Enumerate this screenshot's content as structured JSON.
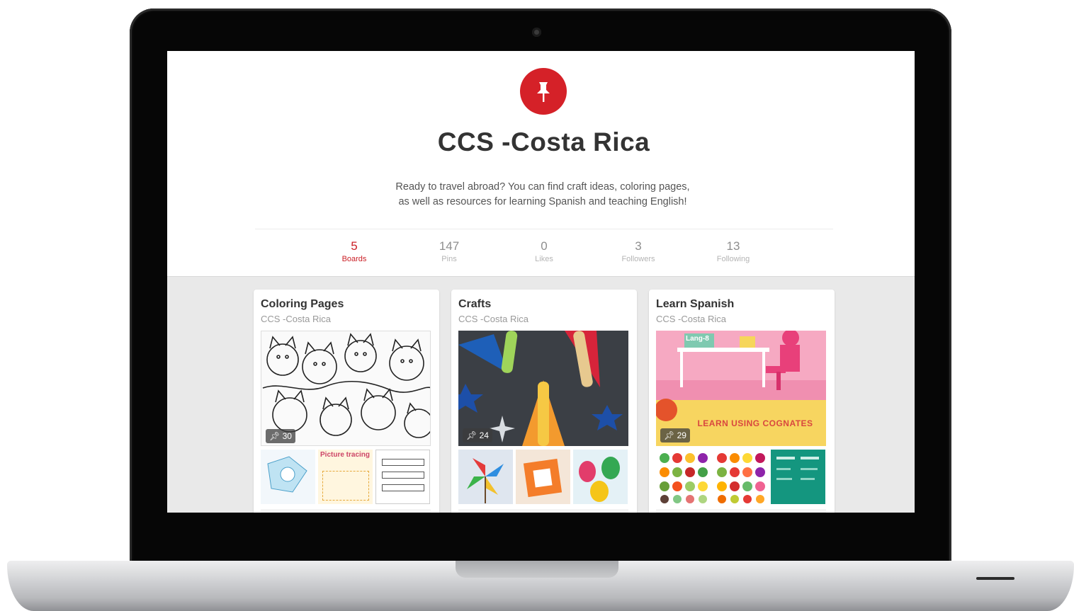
{
  "profile": {
    "name": "CCS -Costa Rica",
    "description_line1": "Ready to travel abroad? You can find craft ideas, coloring pages,",
    "description_line2": "as well as resources for learning Spanish and teaching English!",
    "logo_icon": "pushpin-icon",
    "brand_color": "#d52128"
  },
  "stats": [
    {
      "count": "5",
      "label": "Boards",
      "active": true
    },
    {
      "count": "147",
      "label": "Pins",
      "active": false
    },
    {
      "count": "0",
      "label": "Likes",
      "active": false
    },
    {
      "count": "3",
      "label": "Followers",
      "active": false
    },
    {
      "count": "13",
      "label": "Following",
      "active": false
    }
  ],
  "boards": [
    {
      "title": "Coloring Pages",
      "owner": "CCS -Costa Rica",
      "pin_count": "30",
      "thumb_text": "Picture tracing"
    },
    {
      "title": "Crafts",
      "owner": "CCS -Costa Rica",
      "pin_count": "24"
    },
    {
      "title": "Learn Spanish",
      "owner": "CCS -Costa Rica",
      "pin_count": "29",
      "cover_text": "LEARN USING COGNATES",
      "cover_tag": "Lang-8"
    }
  ]
}
